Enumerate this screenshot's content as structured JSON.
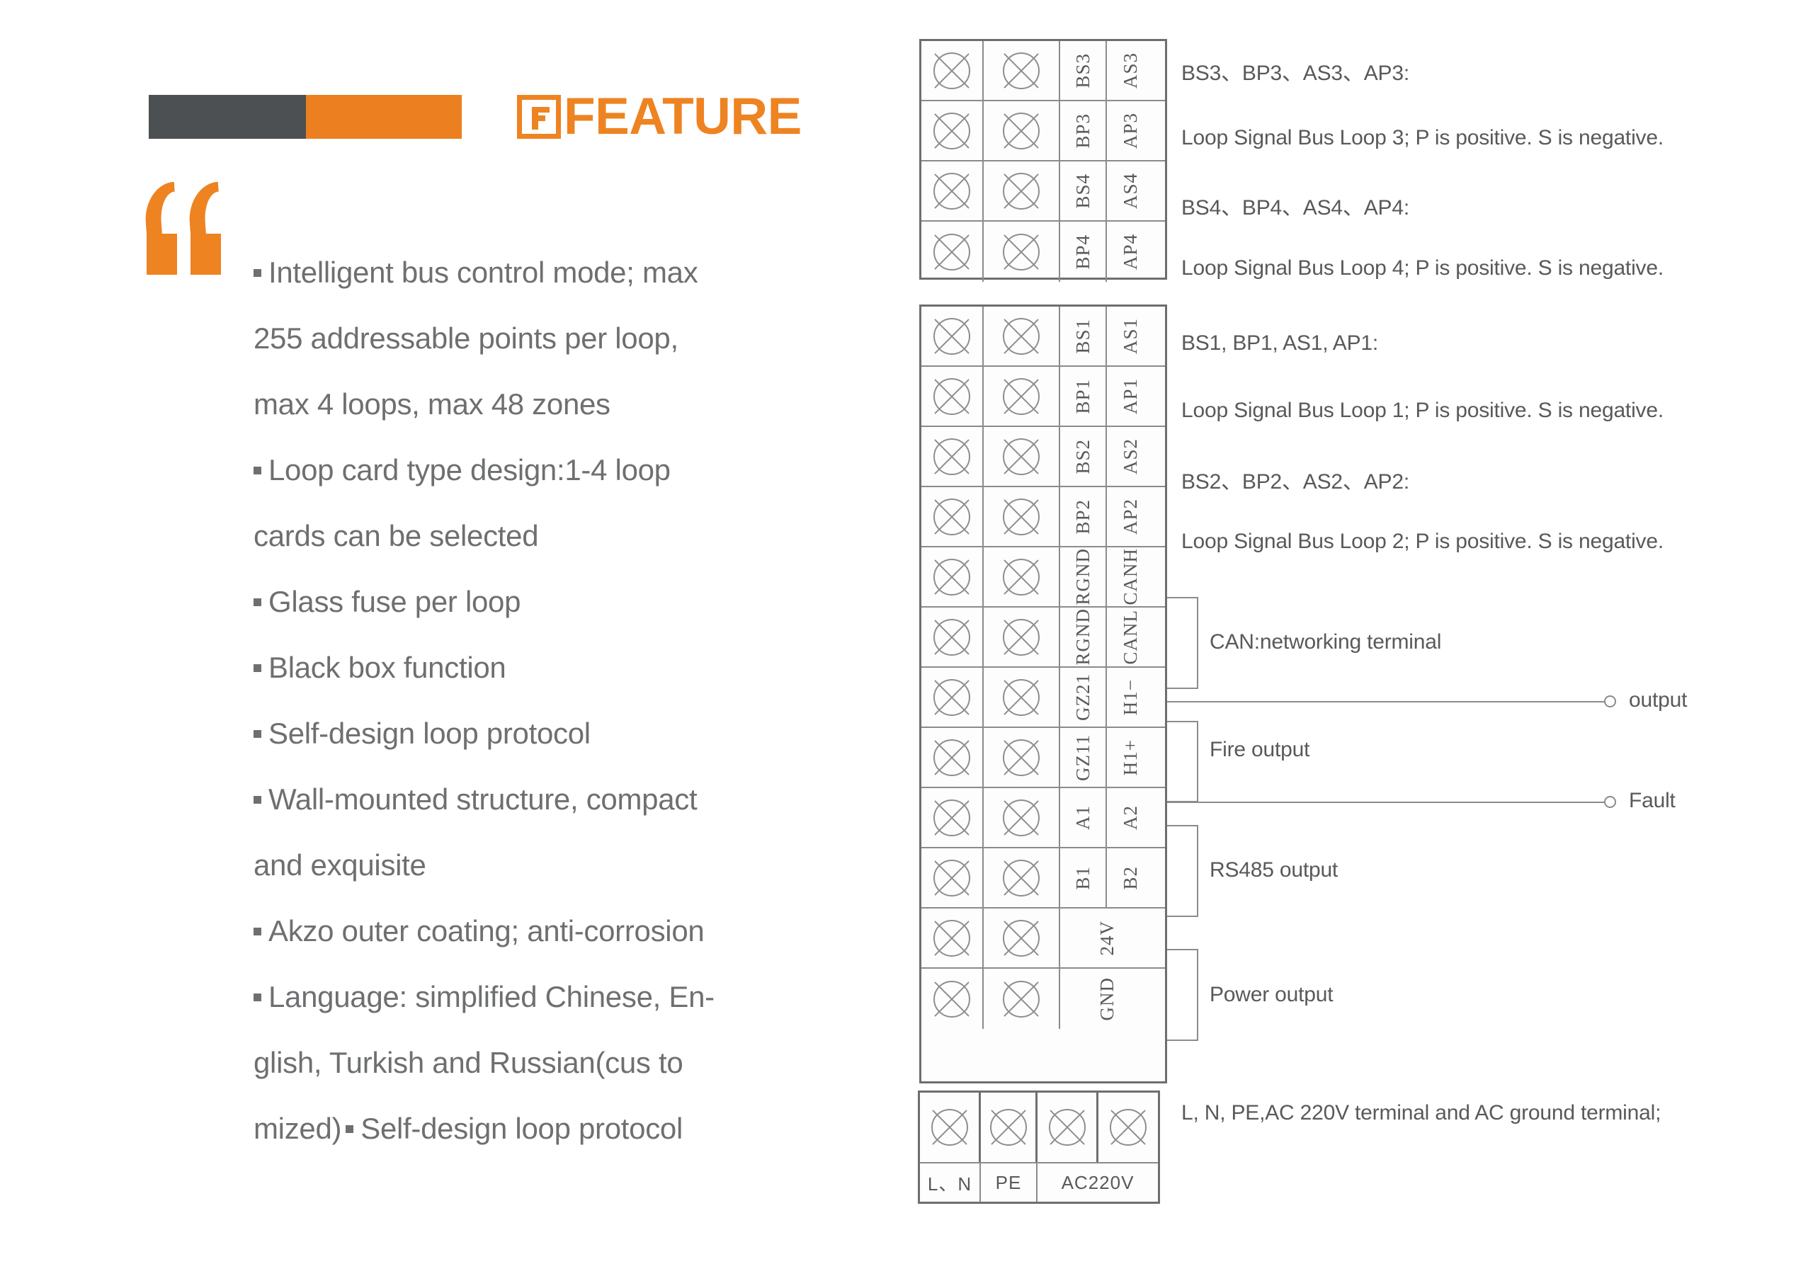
{
  "header": {
    "title": "FEATURE",
    "title_first_letter": "F",
    "accent_color": "#ee8322",
    "dark_bar_color": "#4d5052"
  },
  "features": {
    "quote_icon": "quote-mark-icon",
    "lines": [
      {
        "bullet": true,
        "text": "Intelligent bus control mode; max"
      },
      {
        "bullet": false,
        "text": "255 addressable  points per loop,"
      },
      {
        "bullet": false,
        "text": "max 4 loops, max 48 zones"
      },
      {
        "bullet": true,
        "text": "Loop card type design:1-4 loop"
      },
      {
        "bullet": false,
        "text": "cards can be selected"
      },
      {
        "bullet": true,
        "text": "Glass fuse per loop"
      },
      {
        "bullet": true,
        "text": "Black box function"
      },
      {
        "bullet": true,
        "text": "Self-design loop protocol"
      },
      {
        "bullet": true,
        "text": "Wall-mounted structure, compact"
      },
      {
        "bullet": false,
        "text": "and exquisite"
      },
      {
        "bullet": true,
        "text": "Akzo outer coating; anti-corrosion"
      },
      {
        "bullet": true,
        "text": "Language: simplified Chinese, En-"
      },
      {
        "bullet": false,
        "text": "glish, Turkish and Russian(cus to"
      },
      {
        "bullet": false,
        "text": "mized)",
        "bullet_inline": true,
        "text2": "Self-design loop protocol"
      }
    ]
  },
  "diagram": {
    "block_top": {
      "rows": [
        {
          "label_left": "BS3",
          "label_right": "AS3"
        },
        {
          "label_left": "BP3",
          "label_right": "AP3"
        },
        {
          "label_left": "BS4",
          "label_right": "AS4"
        },
        {
          "label_left": "BP4",
          "label_right": "AP4"
        }
      ]
    },
    "block_main": {
      "rows": [
        {
          "label_left": "BS1",
          "label_right": "AS1"
        },
        {
          "label_left": "BP1",
          "label_right": "AP1"
        },
        {
          "label_left": "BS2",
          "label_right": "AS2"
        },
        {
          "label_left": "BP2",
          "label_right": "AP2"
        },
        {
          "label_left": "RGND",
          "label_right": "CANH"
        },
        {
          "label_left": "RGND",
          "label_right": "CANL"
        },
        {
          "label_left": "GZ21",
          "label_right": "H1−"
        },
        {
          "label_left": "GZ11",
          "label_right": "H1+"
        },
        {
          "label_left": "A1",
          "label_right": "A2"
        },
        {
          "label_left": "B1",
          "label_right": "B2"
        },
        {
          "label_merged": "24V"
        },
        {
          "label_merged": "GND"
        }
      ]
    },
    "block_power": {
      "terminals": [
        "L",
        "N",
        "PE",
        "AC220V"
      ],
      "labels": [
        "L、N",
        "PE",
        "AC220V"
      ]
    },
    "descriptions": {
      "d1": "BS3、BP3、AS3、AP3:",
      "d2": "Loop Signal Bus Loop 3; P is positive. S is negative.",
      "d3": "BS4、BP4、AS4、AP4:",
      "d4": "Loop Signal Bus Loop 4; P is positive. S is negative.",
      "d5": "BS1, BP1, AS1, AP1:",
      "d6": "Loop Signal Bus Loop 1; P is positive. S is negative.",
      "d7": "BS2、BP2、AS2、AP2:",
      "d8": "Loop Signal Bus Loop 2; P is positive. S is negative.",
      "can": "CAN:networking terminal",
      "output": "output",
      "fire": "Fire output",
      "fault": "Fault",
      "rs485": "RS485 output",
      "power": "Power output",
      "mains": "L, N, PE,AC 220V terminal and AC ground terminal;"
    }
  }
}
